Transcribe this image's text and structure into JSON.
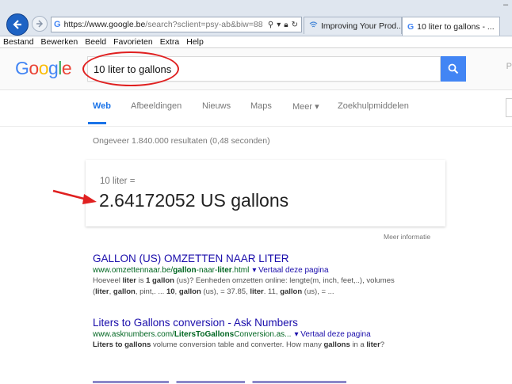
{
  "browser": {
    "url_host": "https://www.google.be",
    "url_path": "/search?sclient=psy-ab&biw=88",
    "tabs": [
      {
        "label": "Improving Your Prod..."
      },
      {
        "label": "10 liter to gallons - ..."
      }
    ],
    "menu": [
      "Bestand",
      "Bewerken",
      "Beeld",
      "Favorieten",
      "Extra",
      "Help"
    ]
  },
  "search": {
    "logo": [
      "G",
      "o",
      "o",
      "g",
      "l",
      "e"
    ],
    "query": "10 liter to gallons",
    "edge_letter": "P"
  },
  "nav": {
    "tabs": [
      "Web",
      "Afbeeldingen",
      "Nieuws",
      "Maps",
      "Meer ▾",
      "Zoekhulpmiddelen"
    ]
  },
  "stats": "Ongeveer 1.840.000 resultaten (0,48 seconden)",
  "answer": {
    "question": "10 liter =",
    "result": "2.64172052 US gallons",
    "more": "Meer informatie"
  },
  "results": [
    {
      "title": "GALLON (US) OMZETTEN NAAR LITER",
      "cite_pre": "www.omzettennaar.be/",
      "cite_b1": "gallon",
      "cite_mid": "-naar-",
      "cite_b2": "liter",
      "cite_post": ".html",
      "translate": "▾ Vertaal deze pagina",
      "s1": "Hoeveel ",
      "s1b": "liter",
      "s2": " is ",
      "s2b": "1 gallon",
      "s3": " (us)? Eenheden omzetten online: lengte(m, inch, feet,..), volumes (",
      "s3b": "liter",
      "s4": ", ",
      "s4b": "gallon",
      "s5": ", pint,. ... ",
      "s5b": "10",
      "s6": ", ",
      "s6b": "gallon",
      "s7": " (us), = 37.85, ",
      "s7b": "liter",
      "s8": ". 11, ",
      "s8b": "gallon",
      "s9": " (us), = ..."
    },
    {
      "title": "Liters to Gallons conversion - Ask Numbers",
      "cite_pre": "www.asknumbers.com/",
      "cite_b1": "LitersToGallons",
      "cite_post": "Conversion.as...",
      "translate": "▾ Vertaal deze pagina",
      "s1b": "Liters to gallons",
      "s2": " volume conversion table and converter. How many ",
      "s2b": "gallons",
      "s3": " in a ",
      "s3b": "liter",
      "s4": "?"
    }
  ],
  "colors": {
    "accent": "#4285f4",
    "link": "#1a0dab",
    "cite": "#006621",
    "annotation": "#e02020"
  }
}
